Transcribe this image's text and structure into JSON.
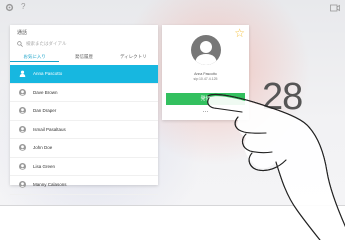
{
  "topbar": {
    "help_label": "?"
  },
  "contacts_panel": {
    "title": "通話",
    "search_placeholder": "検索またはダイアル",
    "tabs": [
      "お気に入り",
      "発信履歴",
      "ディレクトリ"
    ],
    "contacts": [
      {
        "name": "Anna Pascotto",
        "selected": true
      },
      {
        "name": "Dave Brown"
      },
      {
        "name": "Dan Draper"
      },
      {
        "name": "Ismail Pasaltaus"
      },
      {
        "name": "John Doe"
      },
      {
        "name": "Lisa Green"
      },
      {
        "name": "Manny Calasons"
      }
    ]
  },
  "contact_card": {
    "name": "Anna Pascotto",
    "address": "sip:10.47.4.125",
    "call_label": "発信",
    "more_label": "...",
    "favorite_icon": "star-icon"
  },
  "clock": {
    "minutes": "28"
  },
  "colors": {
    "accent": "#17b7e0",
    "call_green": "#33c05f",
    "star": "#f5c242"
  }
}
